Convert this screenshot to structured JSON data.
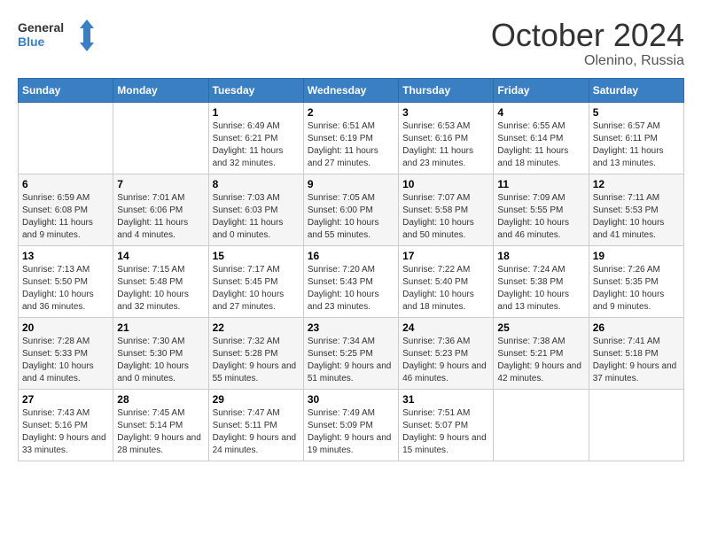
{
  "logo": {
    "line1": "General",
    "line2": "Blue"
  },
  "title": "October 2024",
  "location": "Olenino, Russia",
  "days_header": [
    "Sunday",
    "Monday",
    "Tuesday",
    "Wednesday",
    "Thursday",
    "Friday",
    "Saturday"
  ],
  "weeks": [
    [
      {
        "num": "",
        "info": ""
      },
      {
        "num": "",
        "info": ""
      },
      {
        "num": "1",
        "info": "Sunrise: 6:49 AM\nSunset: 6:21 PM\nDaylight: 11 hours\nand 32 minutes."
      },
      {
        "num": "2",
        "info": "Sunrise: 6:51 AM\nSunset: 6:19 PM\nDaylight: 11 hours\nand 27 minutes."
      },
      {
        "num": "3",
        "info": "Sunrise: 6:53 AM\nSunset: 6:16 PM\nDaylight: 11 hours\nand 23 minutes."
      },
      {
        "num": "4",
        "info": "Sunrise: 6:55 AM\nSunset: 6:14 PM\nDaylight: 11 hours\nand 18 minutes."
      },
      {
        "num": "5",
        "info": "Sunrise: 6:57 AM\nSunset: 6:11 PM\nDaylight: 11 hours\nand 13 minutes."
      }
    ],
    [
      {
        "num": "6",
        "info": "Sunrise: 6:59 AM\nSunset: 6:08 PM\nDaylight: 11 hours\nand 9 minutes."
      },
      {
        "num": "7",
        "info": "Sunrise: 7:01 AM\nSunset: 6:06 PM\nDaylight: 11 hours\nand 4 minutes."
      },
      {
        "num": "8",
        "info": "Sunrise: 7:03 AM\nSunset: 6:03 PM\nDaylight: 11 hours\nand 0 minutes."
      },
      {
        "num": "9",
        "info": "Sunrise: 7:05 AM\nSunset: 6:00 PM\nDaylight: 10 hours\nand 55 minutes."
      },
      {
        "num": "10",
        "info": "Sunrise: 7:07 AM\nSunset: 5:58 PM\nDaylight: 10 hours\nand 50 minutes."
      },
      {
        "num": "11",
        "info": "Sunrise: 7:09 AM\nSunset: 5:55 PM\nDaylight: 10 hours\nand 46 minutes."
      },
      {
        "num": "12",
        "info": "Sunrise: 7:11 AM\nSunset: 5:53 PM\nDaylight: 10 hours\nand 41 minutes."
      }
    ],
    [
      {
        "num": "13",
        "info": "Sunrise: 7:13 AM\nSunset: 5:50 PM\nDaylight: 10 hours\nand 36 minutes."
      },
      {
        "num": "14",
        "info": "Sunrise: 7:15 AM\nSunset: 5:48 PM\nDaylight: 10 hours\nand 32 minutes."
      },
      {
        "num": "15",
        "info": "Sunrise: 7:17 AM\nSunset: 5:45 PM\nDaylight: 10 hours\nand 27 minutes."
      },
      {
        "num": "16",
        "info": "Sunrise: 7:20 AM\nSunset: 5:43 PM\nDaylight: 10 hours\nand 23 minutes."
      },
      {
        "num": "17",
        "info": "Sunrise: 7:22 AM\nSunset: 5:40 PM\nDaylight: 10 hours\nand 18 minutes."
      },
      {
        "num": "18",
        "info": "Sunrise: 7:24 AM\nSunset: 5:38 PM\nDaylight: 10 hours\nand 13 minutes."
      },
      {
        "num": "19",
        "info": "Sunrise: 7:26 AM\nSunset: 5:35 PM\nDaylight: 10 hours\nand 9 minutes."
      }
    ],
    [
      {
        "num": "20",
        "info": "Sunrise: 7:28 AM\nSunset: 5:33 PM\nDaylight: 10 hours\nand 4 minutes."
      },
      {
        "num": "21",
        "info": "Sunrise: 7:30 AM\nSunset: 5:30 PM\nDaylight: 10 hours\nand 0 minutes."
      },
      {
        "num": "22",
        "info": "Sunrise: 7:32 AM\nSunset: 5:28 PM\nDaylight: 9 hours\nand 55 minutes."
      },
      {
        "num": "23",
        "info": "Sunrise: 7:34 AM\nSunset: 5:25 PM\nDaylight: 9 hours\nand 51 minutes."
      },
      {
        "num": "24",
        "info": "Sunrise: 7:36 AM\nSunset: 5:23 PM\nDaylight: 9 hours\nand 46 minutes."
      },
      {
        "num": "25",
        "info": "Sunrise: 7:38 AM\nSunset: 5:21 PM\nDaylight: 9 hours\nand 42 minutes."
      },
      {
        "num": "26",
        "info": "Sunrise: 7:41 AM\nSunset: 5:18 PM\nDaylight: 9 hours\nand 37 minutes."
      }
    ],
    [
      {
        "num": "27",
        "info": "Sunrise: 7:43 AM\nSunset: 5:16 PM\nDaylight: 9 hours\nand 33 minutes."
      },
      {
        "num": "28",
        "info": "Sunrise: 7:45 AM\nSunset: 5:14 PM\nDaylight: 9 hours\nand 28 minutes."
      },
      {
        "num": "29",
        "info": "Sunrise: 7:47 AM\nSunset: 5:11 PM\nDaylight: 9 hours\nand 24 minutes."
      },
      {
        "num": "30",
        "info": "Sunrise: 7:49 AM\nSunset: 5:09 PM\nDaylight: 9 hours\nand 19 minutes."
      },
      {
        "num": "31",
        "info": "Sunrise: 7:51 AM\nSunset: 5:07 PM\nDaylight: 9 hours\nand 15 minutes."
      },
      {
        "num": "",
        "info": ""
      },
      {
        "num": "",
        "info": ""
      }
    ]
  ]
}
